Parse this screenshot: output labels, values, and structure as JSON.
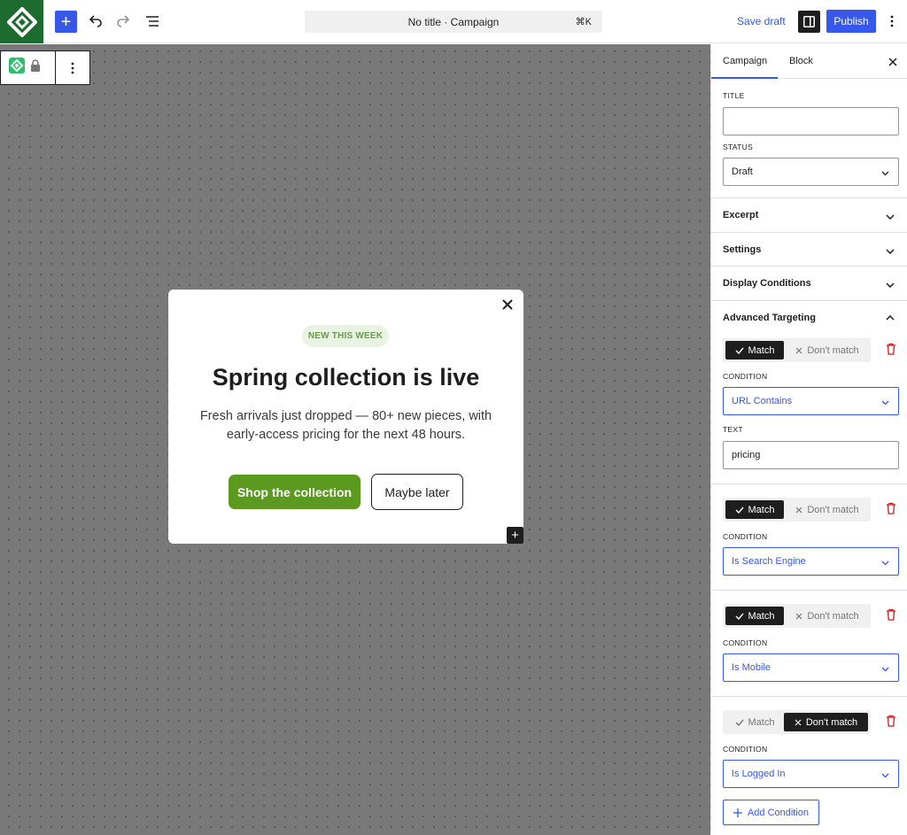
{
  "topbar": {
    "command_text": "No title · Campaign",
    "command_shortcut": "⌘K",
    "save_draft": "Save draft",
    "publish": "Publish"
  },
  "popup": {
    "badge": "NEW THIS WEEK",
    "headline": "Spring collection is live",
    "body_line1": "Fresh arrivals just dropped — 80+ new pieces, with",
    "body_line2": "early-access pricing for the next 48 hours.",
    "primary_cta": "Shop the collection",
    "secondary_cta": "Maybe later"
  },
  "sidebar": {
    "tabs": [
      "Campaign",
      "Block"
    ],
    "title_label": "TITLE",
    "title_value": "",
    "status_label": "STATUS",
    "status_value": "Draft",
    "sections": [
      "Excerpt",
      "Settings",
      "Display Conditions",
      "Advanced Targeting"
    ],
    "match_label": "Match",
    "dont_match_label": "Don't match",
    "condition_label": "CONDITION",
    "text_label": "TEXT",
    "rules": [
      {
        "mode": "match",
        "condition": "URL Contains",
        "text": "pricing"
      },
      {
        "mode": "match",
        "condition": "Is Search Engine"
      },
      {
        "mode": "match",
        "condition": "Is Mobile"
      },
      {
        "mode": "dont_match",
        "condition": "Is Logged In"
      }
    ],
    "add_condition": "Add Condition"
  },
  "colors": {
    "accent": "#3858e9",
    "brand_green": "#1e6b2f",
    "cta_green": "#5b9a1f",
    "canvas": "#797979",
    "danger": "#cc1818"
  }
}
